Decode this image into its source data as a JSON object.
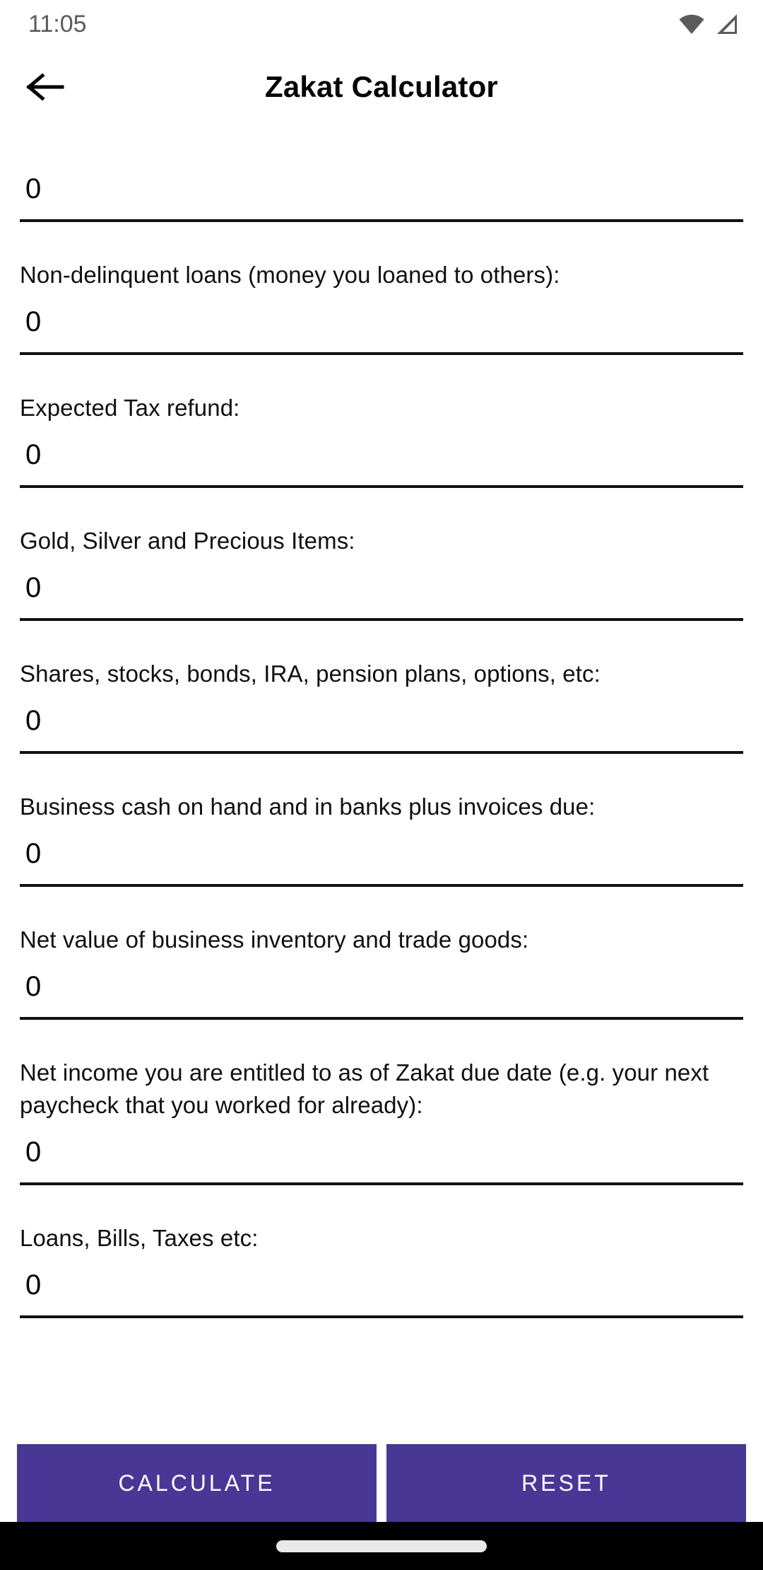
{
  "status_bar": {
    "time": "11:05",
    "icons": [
      "wifi-icon",
      "cellular-signal-icon"
    ]
  },
  "app_bar": {
    "back_icon": "arrow-left-icon",
    "title": "Zakat Calculator"
  },
  "theme": {
    "accent": "#483795",
    "button_text": "#ffffff",
    "text": "#101010",
    "status_text": "#5b5b5b",
    "underline": "#111111",
    "nav_bar_background": "#000000",
    "page_background": "#ffffff"
  },
  "form": {
    "placeholder": "0",
    "fields": [
      {
        "label": "",
        "value": "0",
        "label_visible": false,
        "name": "cash-in-hand-and-bank-field"
      },
      {
        "label": "Non-delinquent loans (money you loaned to others):",
        "value": "0",
        "label_visible": true,
        "name": "non-delinquent-loans-field"
      },
      {
        "label": "Expected Tax refund:",
        "value": "0",
        "label_visible": true,
        "name": "expected-tax-refund-field"
      },
      {
        "label": "Gold, Silver and Precious Items:",
        "value": "0",
        "label_visible": true,
        "name": "gold-silver-precious-items-field"
      },
      {
        "label": "Shares, stocks, bonds, IRA, pension plans, options, etc:",
        "value": "0",
        "label_visible": true,
        "name": "shares-stocks-bonds-field"
      },
      {
        "label": "Business cash on hand and in banks plus invoices due:",
        "value": "0",
        "label_visible": true,
        "name": "business-cash-field"
      },
      {
        "label": "Net value of business inventory and trade goods:",
        "value": "0",
        "label_visible": true,
        "name": "business-inventory-field"
      },
      {
        "label": "Net income you are entitled to as of Zakat due date (e.g. your next paycheck that you worked for already):",
        "value": "0",
        "label_visible": true,
        "name": "net-income-entitled-field"
      },
      {
        "label": "Loans, Bills, Taxes etc:",
        "value": "0",
        "label_visible": true,
        "name": "loans-bills-taxes-field"
      }
    ]
  },
  "actions": {
    "calculate_label": "CALCULATE",
    "reset_label": "RESET"
  },
  "nav_bar": {
    "home_indicator": "home-indicator-pill"
  }
}
